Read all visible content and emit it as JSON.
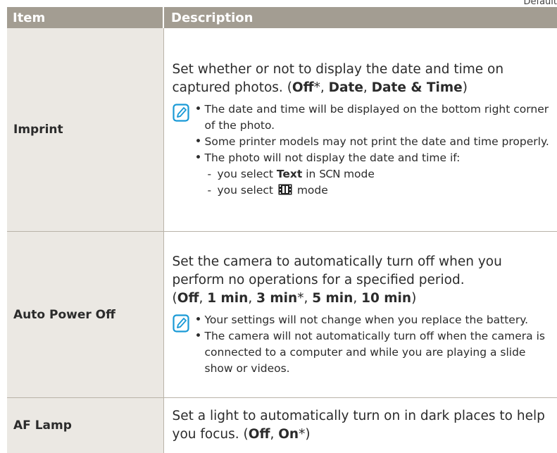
{
  "corner_label": "Default",
  "header": {
    "item": "Item",
    "description": "Description"
  },
  "rows": [
    {
      "item": "Imprint",
      "desc_text": "Set whether or not to display the date and time on captured photos. (",
      "options": [
        {
          "label": "Off",
          "default": true
        },
        {
          "label": "Date",
          "default": false
        },
        {
          "label": "Date & Time",
          "default": false
        }
      ],
      "notes": [
        "The date and time will be displayed on the bottom right corner of the photo.",
        "Some printer models may not print the date and time properly.",
        "The photo will not display the date and time if:"
      ],
      "subnotes": [
        {
          "prefix": "you select ",
          "bold": "Text",
          "middle": " in ",
          "mode": "SCN",
          "suffix": " mode"
        },
        {
          "prefix": "you select ",
          "icon": "film-mode-icon",
          "suffix": " mode"
        }
      ]
    },
    {
      "item": "Auto Power Off",
      "desc_text": "Set the camera to automatically turn off when you perform no operations for a specified period.",
      "options": [
        {
          "label": "Off",
          "default": false
        },
        {
          "label": "1 min",
          "default": false
        },
        {
          "label": "3 min",
          "default": true
        },
        {
          "label": "5 min",
          "default": false
        },
        {
          "label": "10 min",
          "default": false
        }
      ],
      "notes": [
        "Your settings will not change when you replace the battery.",
        "The camera will not automatically turn off when the camera is connected to a computer and while you are playing a slide show or videos."
      ]
    },
    {
      "item": "AF Lamp",
      "desc_text": "Set a light to automatically turn on in dark places to help you focus. (",
      "options": [
        {
          "label": "Off",
          "default": false
        },
        {
          "label": "On",
          "default": true
        }
      ]
    }
  ],
  "symbols": {
    "default_marker": "*",
    "separator": ", ",
    "close_paren": ")",
    "open_paren": "("
  },
  "colors": {
    "header_bg": "#a39d92",
    "item_bg": "#ebe8e3",
    "note_icon": "#1a9ad6"
  }
}
